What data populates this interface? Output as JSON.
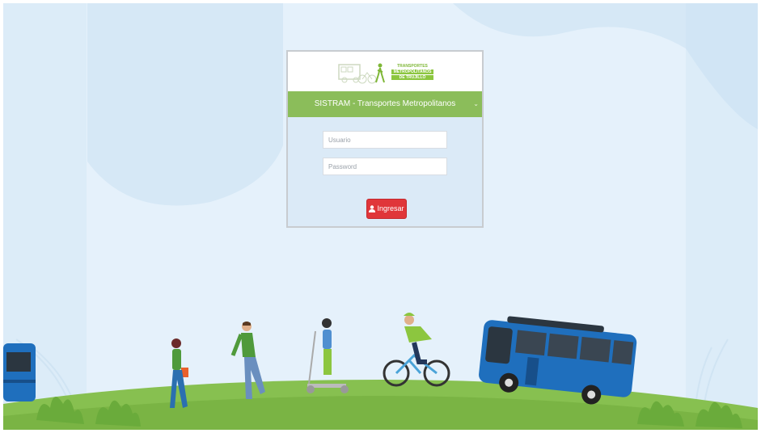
{
  "logo": {
    "line1": "TRANSPORTES",
    "line2": "METROPOLITANOS",
    "line3": "DE TRUJILLO"
  },
  "login": {
    "title": "SISTRAM - Transportes Metropolitanos",
    "username_placeholder": "Usuario",
    "password_placeholder": "Password",
    "submit_label": "Ingresar"
  },
  "colors": {
    "brand_green": "#8bbd5a",
    "button_red": "#e0363a",
    "sky": "#e3f1fb",
    "grass": "#86bf4f",
    "bus_blue": "#1f6fbd"
  },
  "icons": [
    "user-icon",
    "chevron-down-icon"
  ]
}
